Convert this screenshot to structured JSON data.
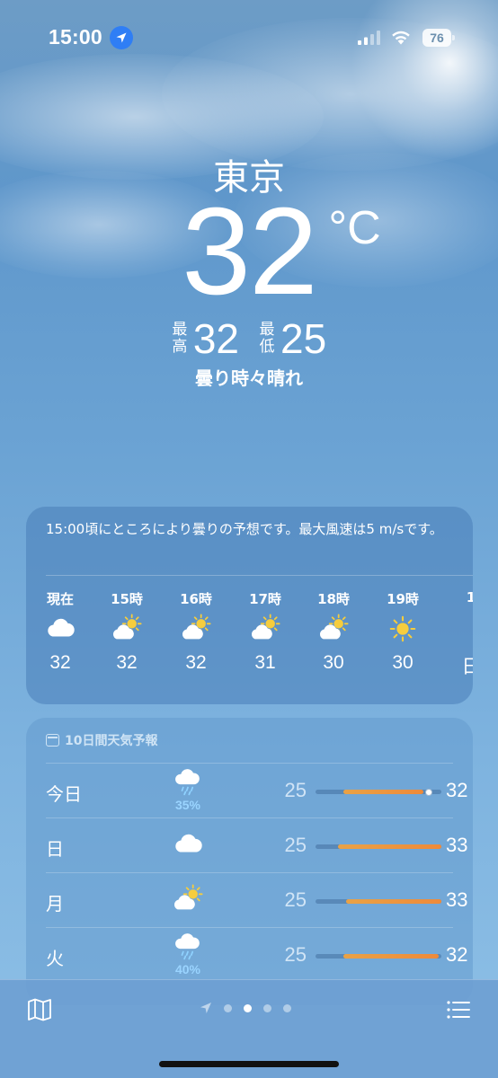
{
  "status_bar": {
    "time": "15:00",
    "battery": "76"
  },
  "hero": {
    "city": "東京",
    "temperature": "32",
    "unit": "°C",
    "high_label": "最高",
    "high_value": "32",
    "low_label": "最低",
    "low_value": "25",
    "condition": "曇り時々晴れ"
  },
  "hourly": {
    "summary": "15:00頃にところにより曇りの予想です。最大風速は5 m/sです。",
    "hours": [
      {
        "label": "現在",
        "icon": "cloud-icon",
        "temp": "32"
      },
      {
        "label": "15時",
        "icon": "partly-sunny-icon",
        "temp": "32"
      },
      {
        "label": "16時",
        "icon": "partly-sunny-icon",
        "temp": "32"
      },
      {
        "label": "17時",
        "icon": "partly-sunny-icon",
        "temp": "31"
      },
      {
        "label": "18時",
        "icon": "partly-sunny-icon",
        "temp": "30"
      },
      {
        "label": "19時",
        "icon": "sun-icon",
        "temp": "30"
      },
      {
        "label": "1",
        "icon": "",
        "temp": "日"
      }
    ]
  },
  "daily": {
    "title": "10日間天気予報",
    "days": [
      {
        "name": "今日",
        "icon": "rain-cloud-icon",
        "precip": "35%",
        "low": "25",
        "high": "32",
        "bar_start": 0.22,
        "bar_end": 0.86,
        "current": 0.9
      },
      {
        "name": "日",
        "icon": "cloud-icon",
        "precip": "",
        "low": "25",
        "high": "33",
        "bar_start": 0.18,
        "bar_end": 1.0,
        "current": null
      },
      {
        "name": "月",
        "icon": "partly-sunny-icon",
        "precip": "",
        "low": "25",
        "high": "33",
        "bar_start": 0.24,
        "bar_end": 1.0,
        "current": null
      },
      {
        "name": "火",
        "icon": "rain-cloud-icon",
        "precip": "40%",
        "low": "25",
        "high": "32",
        "bar_start": 0.22,
        "bar_end": 0.98,
        "current": null
      }
    ]
  },
  "toolbar": {
    "pages": 4,
    "active_page": 1
  },
  "colors": {
    "location_badge": "#2f7ef5",
    "temp_bar": "#ee8a3a",
    "precip": "#9ad4ff"
  }
}
